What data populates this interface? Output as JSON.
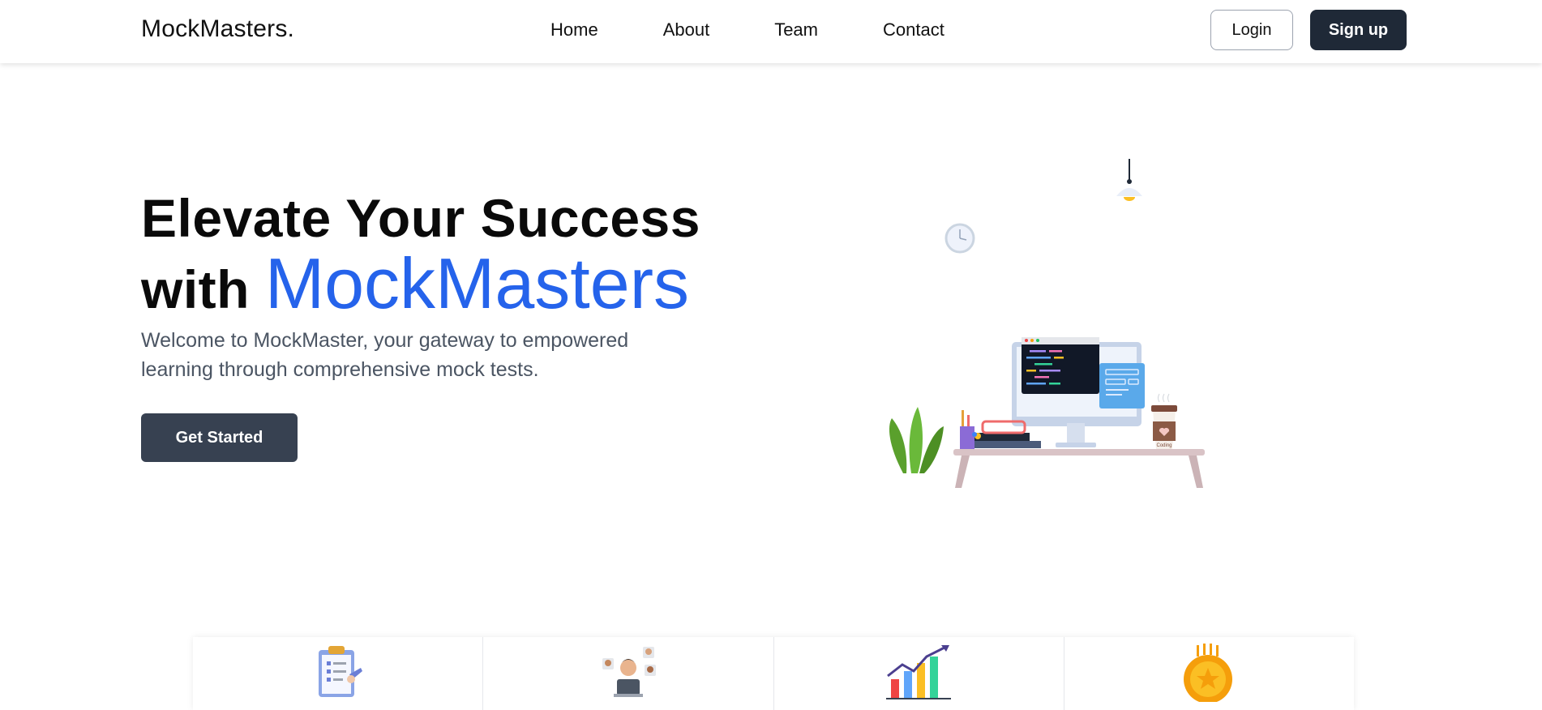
{
  "header": {
    "brand": "MockMasters.",
    "nav": [
      "Home",
      "About",
      "Team",
      "Contact"
    ],
    "login_label": "Login",
    "signup_label": "Sign up"
  },
  "hero": {
    "title_line1": "Elevate Your Success",
    "title_with": "with",
    "title_accent": "MockMasters",
    "subtitle": "Welcome to MockMaster, your gateway to empowered learning through comprehensive mock tests.",
    "cta_label": "Get Started",
    "cup_label": "Coding"
  },
  "features": {
    "icons": [
      "clipboard-checklist-icon",
      "online-interview-icon",
      "growth-chart-icon",
      "gold-medal-icon"
    ]
  },
  "colors": {
    "accent": "#2563eb",
    "dark_button": "#1f2937",
    "cta_button": "#374151"
  }
}
